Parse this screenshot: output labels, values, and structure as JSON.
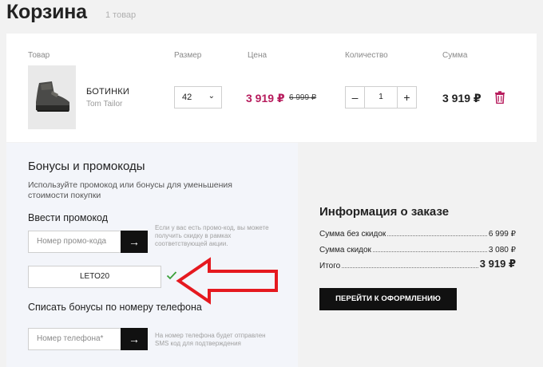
{
  "header": {
    "title": "Корзина",
    "count": "1 товар"
  },
  "cart": {
    "columns": {
      "product": "Товар",
      "size": "Размер",
      "price": "Цена",
      "quantity": "Количество",
      "sum": "Сумма"
    },
    "item": {
      "name": "БОТИНКИ",
      "brand": "Tom Tailor",
      "size": "42",
      "price": "3 919 ₽",
      "old_price": "6 999 ₽",
      "quantity": "1",
      "minus": "–",
      "plus": "+",
      "sum": "3 919 ₽"
    }
  },
  "bonuses": {
    "title": "Бонусы и промокоды",
    "description": "Используйте промокод или бонусы для уменьшения стоимости покупки",
    "promo_title": "Ввести промокод",
    "promo_placeholder": "Номер промо-кода",
    "promo_hint": "Если у вас есть промо-код, вы можете получить скидку в рамках соответствующей акции.",
    "promo_applied": "LETO20",
    "phone_title": "Списать бонусы по номеру телефона",
    "phone_placeholder": "Номер телефона*",
    "phone_hint": "На номер телефона будет отправлен SMS код для подтверждения",
    "go_label": "→"
  },
  "order": {
    "title": "Информация о заказе",
    "rows": [
      {
        "label": "Сумма без скидок",
        "value": "6 999 ₽"
      },
      {
        "label": "Сумма скидок",
        "value": "3 080 ₽"
      },
      {
        "label": "Итого",
        "value": "3 919 ₽"
      }
    ],
    "checkout_label": "ПЕРЕЙТИ К ОФОРМЛЕНИЮ"
  },
  "colors": {
    "accent": "#b71c5d",
    "arrow": "#e5191f",
    "check": "#3aa03a",
    "button": "#111111",
    "panel": "#f3f5fa"
  },
  "icons": {
    "trash": "trash-icon",
    "arrow_right": "arrow-right-icon",
    "check": "check-icon",
    "chevron": "chevron-down-icon"
  }
}
